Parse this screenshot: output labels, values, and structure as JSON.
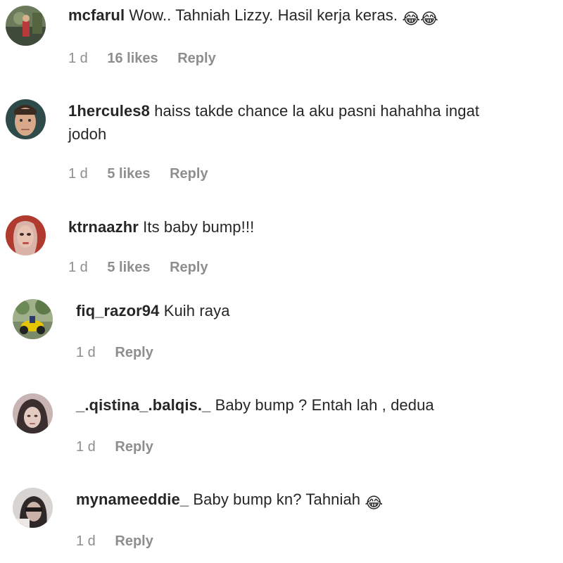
{
  "comments": [
    {
      "username": "mcfarul",
      "text": "Wow.. Tahniah Lizzy. Hasil kerja keras.",
      "emoji": "😂😂",
      "time": "1 d",
      "likes": "16 likes",
      "reply": "Reply"
    },
    {
      "username": "1hercules8",
      "text": "haiss takde chance la aku pasni hahahha ingat",
      "text2": "jodoh",
      "time": "1 d",
      "likes": "5 likes",
      "reply": "Reply"
    },
    {
      "username": "ktrnaazhr",
      "text": "Its baby bump!!!",
      "time": "1 d",
      "likes": "5 likes",
      "reply": "Reply"
    },
    {
      "username": "fiq_razor94",
      "text": "Kuih raya",
      "time": "1 d",
      "reply": "Reply"
    },
    {
      "username": "_.qistina_.balqis._",
      "text": "Baby bump ? Entah lah , dedua",
      "time": "1 d",
      "reply": "Reply"
    },
    {
      "username": "mynameeddie_",
      "text": "Baby bump kn? Tahniah",
      "emoji": "😂",
      "time": "1 d",
      "reply": "Reply"
    }
  ],
  "colors": {
    "text": "#262626",
    "secondary": "#8e8e8e",
    "background": "#ffffff"
  }
}
